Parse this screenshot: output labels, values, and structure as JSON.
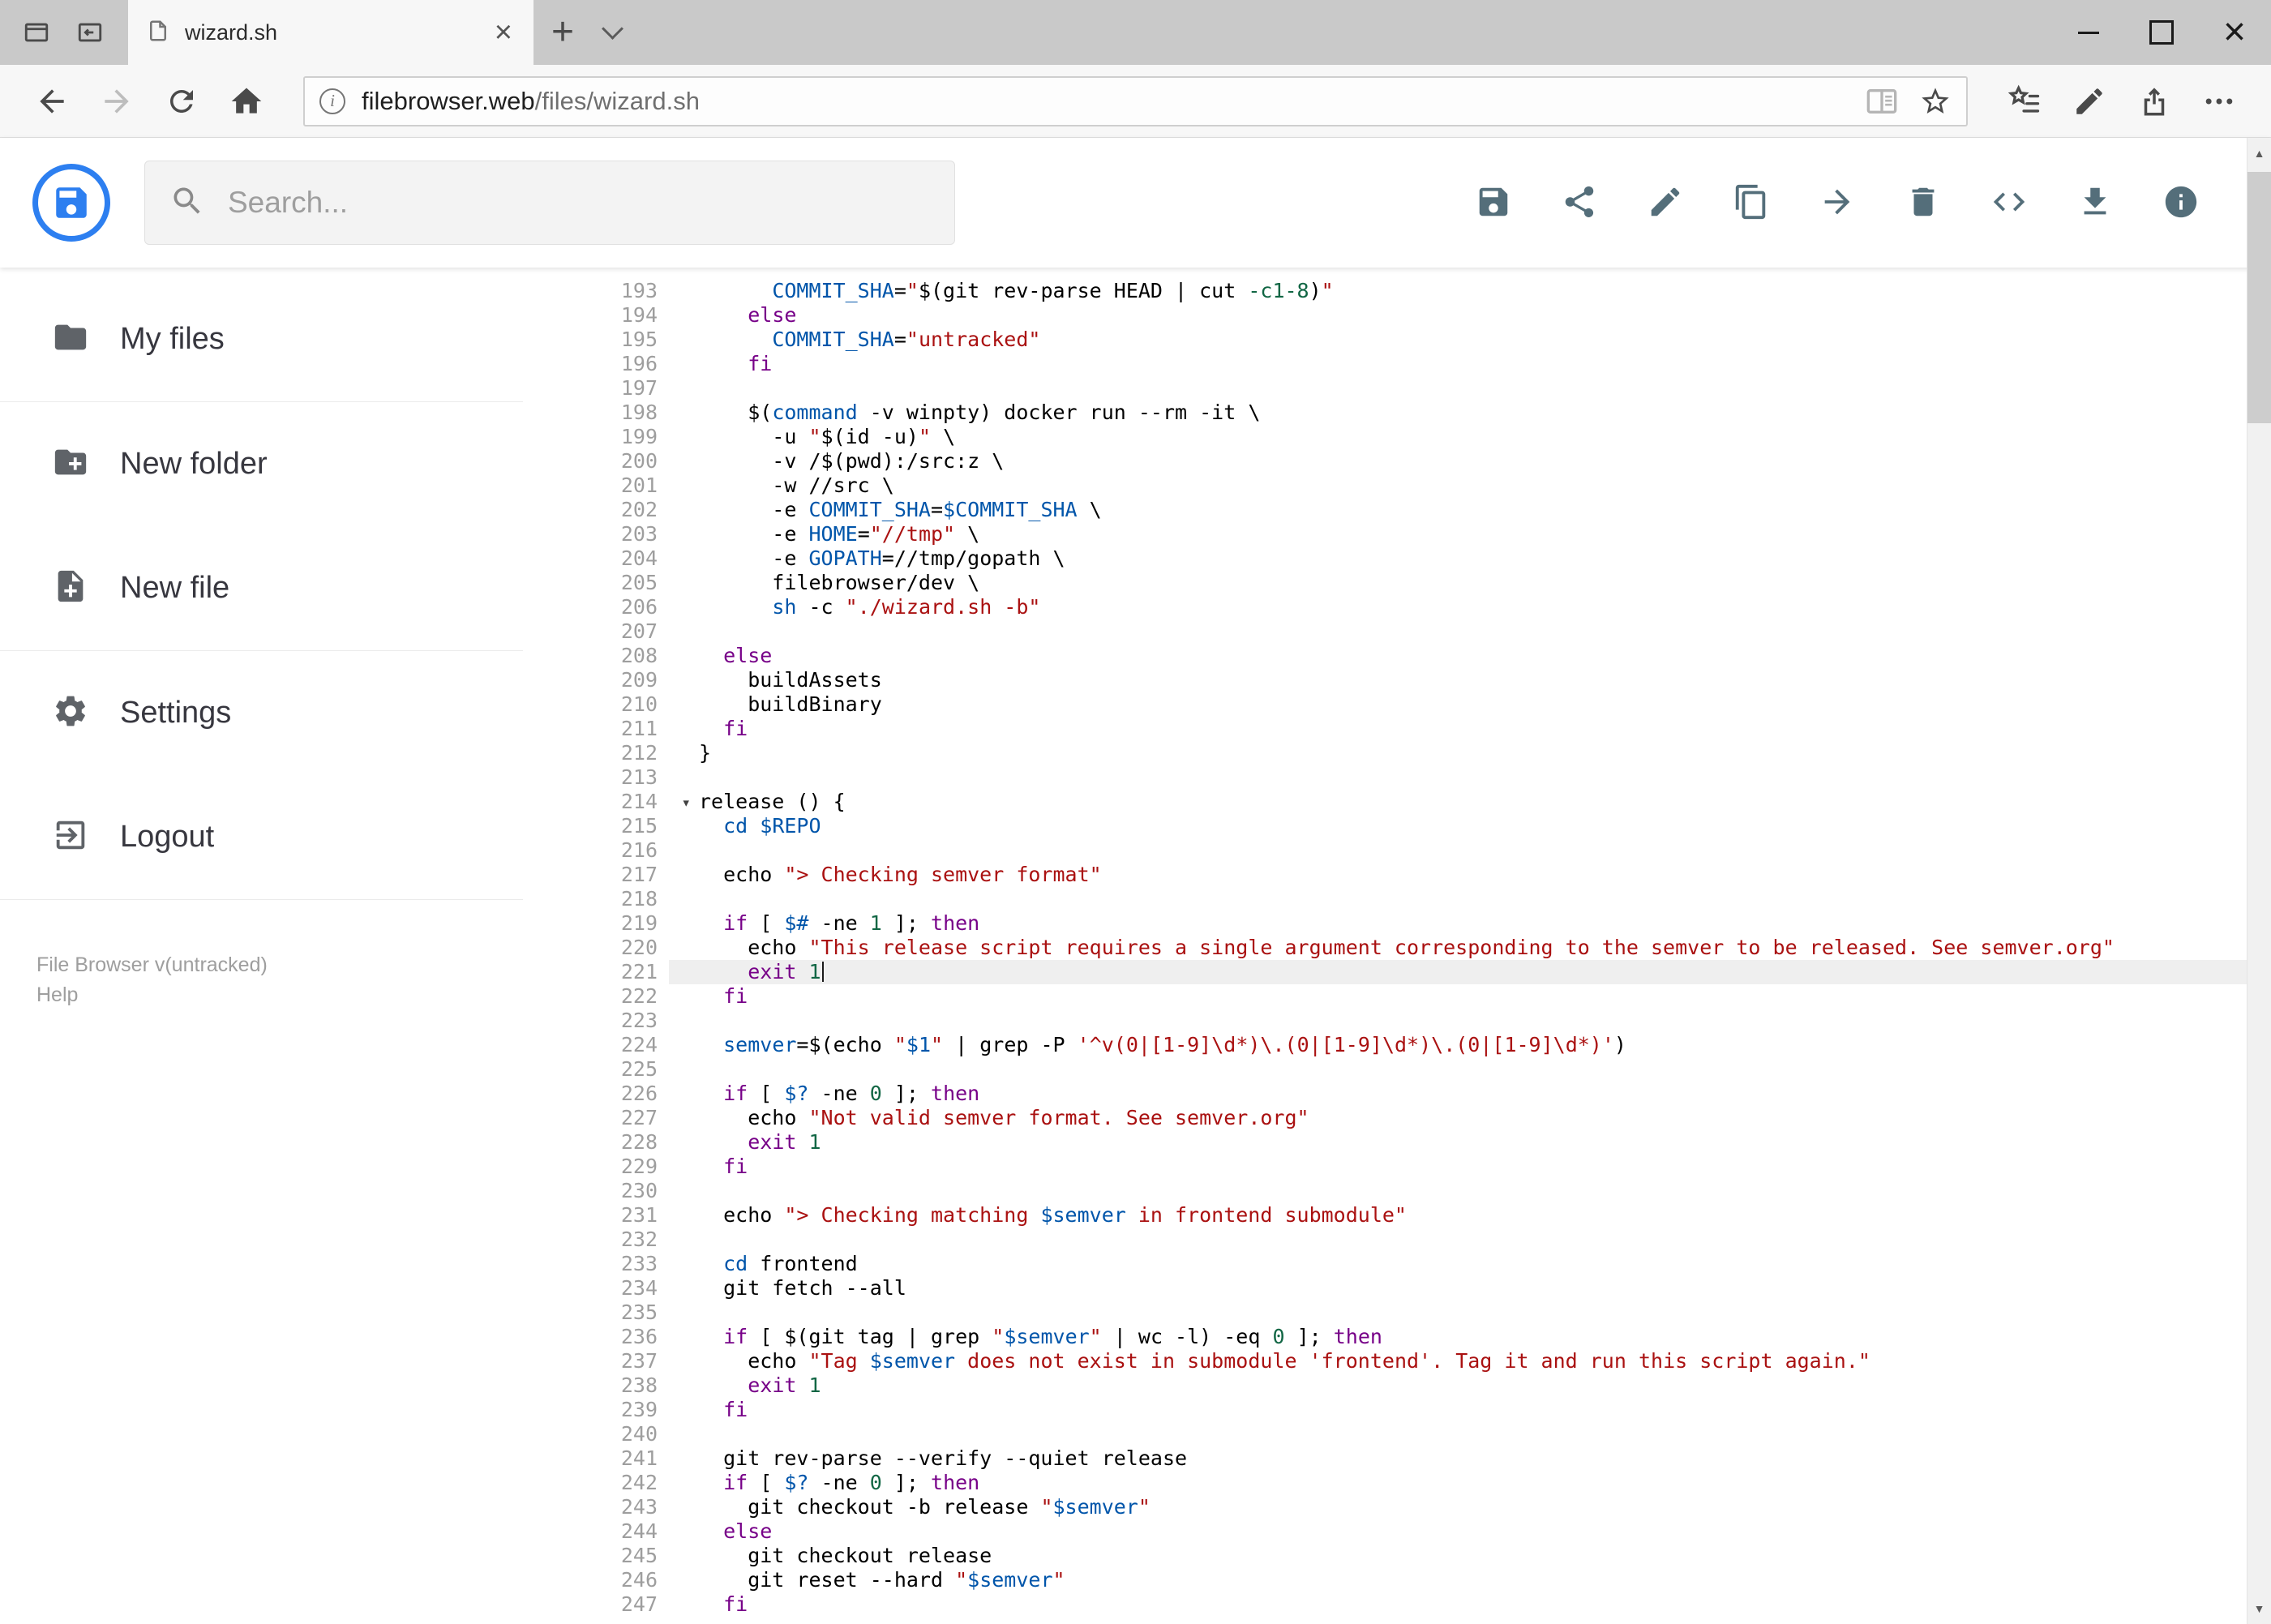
{
  "browser": {
    "tab_title": "wizard.sh",
    "url_host": "filebrowser.web",
    "url_path": "/files/wizard.sh"
  },
  "app": {
    "search_placeholder": "Search...",
    "accent_color": "#2d7ff0",
    "toolbar_icon_color": "#546e7a",
    "toolbar": [
      {
        "name": "save",
        "icon": "save-icon"
      },
      {
        "name": "share",
        "icon": "share-icon"
      },
      {
        "name": "edit",
        "icon": "pencil-icon"
      },
      {
        "name": "copy",
        "icon": "copy-icon"
      },
      {
        "name": "move",
        "icon": "arrow-forward-icon"
      },
      {
        "name": "delete",
        "icon": "trash-icon"
      },
      {
        "name": "code",
        "icon": "code-icon"
      },
      {
        "name": "download",
        "icon": "download-icon"
      },
      {
        "name": "info",
        "icon": "info-icon"
      }
    ],
    "sidebar": {
      "groups": [
        [
          {
            "label": "My files",
            "icon": "folder-icon"
          }
        ],
        [
          {
            "label": "New folder",
            "icon": "new-folder-icon"
          },
          {
            "label": "New file",
            "icon": "new-file-icon"
          }
        ],
        [
          {
            "label": "Settings",
            "icon": "settings-icon"
          },
          {
            "label": "Logout",
            "icon": "logout-icon"
          }
        ]
      ],
      "footer_version": "File Browser v(untracked)",
      "footer_help": "Help"
    }
  },
  "editor": {
    "active_line": 221,
    "token_colors": {
      "p": "#000000",
      "k": "#770088",
      "s": "#aa1111",
      "v": "#0055aa",
      "n": "#116644",
      "b": "#0055aa"
    },
    "lines": [
      {
        "n": 193,
        "t": [
          [
            "p",
            "      "
          ],
          [
            "v",
            "COMMIT_SHA"
          ],
          [
            "p",
            "="
          ],
          [
            "s",
            "\""
          ],
          [
            "p",
            "$(git rev-parse HEAD | cut "
          ],
          [
            "n",
            "-c1-8"
          ],
          [
            "p",
            ")"
          ],
          [
            "s",
            "\""
          ]
        ]
      },
      {
        "n": 194,
        "t": [
          [
            "p",
            "    "
          ],
          [
            "k",
            "else"
          ]
        ]
      },
      {
        "n": 195,
        "t": [
          [
            "p",
            "      "
          ],
          [
            "v",
            "COMMIT_SHA"
          ],
          [
            "p",
            "="
          ],
          [
            "s",
            "\"untracked\""
          ]
        ]
      },
      {
        "n": 196,
        "t": [
          [
            "p",
            "    "
          ],
          [
            "k",
            "fi"
          ]
        ]
      },
      {
        "n": 197,
        "t": []
      },
      {
        "n": 198,
        "t": [
          [
            "p",
            "    $("
          ],
          [
            "b",
            "command"
          ],
          [
            "p",
            " -v winpty) docker run --rm -it \\"
          ]
        ]
      },
      {
        "n": 199,
        "t": [
          [
            "p",
            "      -u "
          ],
          [
            "s",
            "\""
          ],
          [
            "p",
            "$(id -u)"
          ],
          [
            "s",
            "\""
          ],
          [
            "p",
            " \\"
          ]
        ]
      },
      {
        "n": 200,
        "t": [
          [
            "p",
            "      -v /$(pwd):/src:z \\"
          ]
        ]
      },
      {
        "n": 201,
        "t": [
          [
            "p",
            "      -w //src \\"
          ]
        ]
      },
      {
        "n": 202,
        "t": [
          [
            "p",
            "      -e "
          ],
          [
            "v",
            "COMMIT_SHA"
          ],
          [
            "p",
            "="
          ],
          [
            "v",
            "$COMMIT_SHA"
          ],
          [
            "p",
            " \\"
          ]
        ]
      },
      {
        "n": 203,
        "t": [
          [
            "p",
            "      -e "
          ],
          [
            "v",
            "HOME"
          ],
          [
            "p",
            "="
          ],
          [
            "s",
            "\"//tmp\""
          ],
          [
            "p",
            " \\"
          ]
        ]
      },
      {
        "n": 204,
        "t": [
          [
            "p",
            "      -e "
          ],
          [
            "v",
            "GOPATH"
          ],
          [
            "p",
            "=//tmp/gopath \\"
          ]
        ]
      },
      {
        "n": 205,
        "t": [
          [
            "p",
            "      filebrowser/dev \\"
          ]
        ]
      },
      {
        "n": 206,
        "t": [
          [
            "p",
            "      "
          ],
          [
            "b",
            "sh"
          ],
          [
            "p",
            " -c "
          ],
          [
            "s",
            "\"./wizard.sh -b\""
          ]
        ]
      },
      {
        "n": 207,
        "t": []
      },
      {
        "n": 208,
        "t": [
          [
            "p",
            "  "
          ],
          [
            "k",
            "else"
          ]
        ]
      },
      {
        "n": 209,
        "t": [
          [
            "p",
            "    buildAssets"
          ]
        ]
      },
      {
        "n": 210,
        "t": [
          [
            "p",
            "    buildBinary"
          ]
        ]
      },
      {
        "n": 211,
        "t": [
          [
            "p",
            "  "
          ],
          [
            "k",
            "fi"
          ]
        ]
      },
      {
        "n": 212,
        "t": [
          [
            "p",
            "}"
          ]
        ]
      },
      {
        "n": 213,
        "t": []
      },
      {
        "n": 214,
        "fold": true,
        "t": [
          [
            "p",
            "release () {"
          ]
        ]
      },
      {
        "n": 215,
        "t": [
          [
            "p",
            "  "
          ],
          [
            "b",
            "cd"
          ],
          [
            "p",
            " "
          ],
          [
            "v",
            "$REPO"
          ]
        ]
      },
      {
        "n": 216,
        "t": []
      },
      {
        "n": 217,
        "t": [
          [
            "p",
            "  echo "
          ],
          [
            "s",
            "\"> Checking semver format\""
          ]
        ]
      },
      {
        "n": 218,
        "t": []
      },
      {
        "n": 219,
        "t": [
          [
            "p",
            "  "
          ],
          [
            "k",
            "if"
          ],
          [
            "p",
            " [ "
          ],
          [
            "v",
            "$#"
          ],
          [
            "p",
            " -ne "
          ],
          [
            "n",
            "1"
          ],
          [
            "p",
            " ]; "
          ],
          [
            "k",
            "then"
          ]
        ]
      },
      {
        "n": 220,
        "t": [
          [
            "p",
            "    echo "
          ],
          [
            "s",
            "\"This release script requires a single argument corresponding to the semver to be released. See semver.org\""
          ]
        ]
      },
      {
        "n": 221,
        "caret": true,
        "t": [
          [
            "p",
            "    "
          ],
          [
            "k",
            "exit"
          ],
          [
            "p",
            " "
          ],
          [
            "n",
            "1"
          ]
        ]
      },
      {
        "n": 222,
        "t": [
          [
            "p",
            "  "
          ],
          [
            "k",
            "fi"
          ]
        ]
      },
      {
        "n": 223,
        "t": []
      },
      {
        "n": 224,
        "t": [
          [
            "p",
            "  "
          ],
          [
            "v",
            "semver"
          ],
          [
            "p",
            "=$(echo "
          ],
          [
            "s",
            "\""
          ],
          [
            "v",
            "$1"
          ],
          [
            "s",
            "\""
          ],
          [
            "p",
            " | grep -P "
          ],
          [
            "s",
            "'^v(0|[1-9]\\d*)\\.(0|[1-9]\\d*)\\.(0|[1-9]\\d*)'"
          ],
          [
            "p",
            ")"
          ]
        ]
      },
      {
        "n": 225,
        "t": []
      },
      {
        "n": 226,
        "t": [
          [
            "p",
            "  "
          ],
          [
            "k",
            "if"
          ],
          [
            "p",
            " [ "
          ],
          [
            "v",
            "$?"
          ],
          [
            "p",
            " -ne "
          ],
          [
            "n",
            "0"
          ],
          [
            "p",
            " ]; "
          ],
          [
            "k",
            "then"
          ]
        ]
      },
      {
        "n": 227,
        "t": [
          [
            "p",
            "    echo "
          ],
          [
            "s",
            "\"Not valid semver format. See semver.org\""
          ]
        ]
      },
      {
        "n": 228,
        "t": [
          [
            "p",
            "    "
          ],
          [
            "k",
            "exit"
          ],
          [
            "p",
            " "
          ],
          [
            "n",
            "1"
          ]
        ]
      },
      {
        "n": 229,
        "t": [
          [
            "p",
            "  "
          ],
          [
            "k",
            "fi"
          ]
        ]
      },
      {
        "n": 230,
        "t": []
      },
      {
        "n": 231,
        "t": [
          [
            "p",
            "  echo "
          ],
          [
            "s",
            "\"> Checking matching "
          ],
          [
            "v",
            "$semver"
          ],
          [
            "s",
            " in frontend submodule\""
          ]
        ]
      },
      {
        "n": 232,
        "t": []
      },
      {
        "n": 233,
        "t": [
          [
            "p",
            "  "
          ],
          [
            "b",
            "cd"
          ],
          [
            "p",
            " frontend"
          ]
        ]
      },
      {
        "n": 234,
        "t": [
          [
            "p",
            "  git fetch --all"
          ]
        ]
      },
      {
        "n": 235,
        "t": []
      },
      {
        "n": 236,
        "t": [
          [
            "p",
            "  "
          ],
          [
            "k",
            "if"
          ],
          [
            "p",
            " [ $(git tag | grep "
          ],
          [
            "s",
            "\""
          ],
          [
            "v",
            "$semver"
          ],
          [
            "s",
            "\""
          ],
          [
            "p",
            " | wc -l) -eq "
          ],
          [
            "n",
            "0"
          ],
          [
            "p",
            " ]; "
          ],
          [
            "k",
            "then"
          ]
        ]
      },
      {
        "n": 237,
        "t": [
          [
            "p",
            "    echo "
          ],
          [
            "s",
            "\"Tag "
          ],
          [
            "v",
            "$semver"
          ],
          [
            "s",
            " does not exist in submodule 'frontend'. Tag it and run this script again.\""
          ]
        ]
      },
      {
        "n": 238,
        "t": [
          [
            "p",
            "    "
          ],
          [
            "k",
            "exit"
          ],
          [
            "p",
            " "
          ],
          [
            "n",
            "1"
          ]
        ]
      },
      {
        "n": 239,
        "t": [
          [
            "p",
            "  "
          ],
          [
            "k",
            "fi"
          ]
        ]
      },
      {
        "n": 240,
        "t": []
      },
      {
        "n": 241,
        "t": [
          [
            "p",
            "  git rev-parse --verify --quiet release"
          ]
        ]
      },
      {
        "n": 242,
        "t": [
          [
            "p",
            "  "
          ],
          [
            "k",
            "if"
          ],
          [
            "p",
            " [ "
          ],
          [
            "v",
            "$?"
          ],
          [
            "p",
            " -ne "
          ],
          [
            "n",
            "0"
          ],
          [
            "p",
            " ]; "
          ],
          [
            "k",
            "then"
          ]
        ]
      },
      {
        "n": 243,
        "t": [
          [
            "p",
            "    git checkout -b release "
          ],
          [
            "s",
            "\""
          ],
          [
            "v",
            "$semver"
          ],
          [
            "s",
            "\""
          ]
        ]
      },
      {
        "n": 244,
        "t": [
          [
            "p",
            "  "
          ],
          [
            "k",
            "else"
          ]
        ]
      },
      {
        "n": 245,
        "t": [
          [
            "p",
            "    git checkout release"
          ]
        ]
      },
      {
        "n": 246,
        "t": [
          [
            "p",
            "    git reset --hard "
          ],
          [
            "s",
            "\""
          ],
          [
            "v",
            "$semver"
          ],
          [
            "s",
            "\""
          ]
        ]
      },
      {
        "n": 247,
        "t": [
          [
            "p",
            "  "
          ],
          [
            "k",
            "fi"
          ]
        ]
      }
    ]
  }
}
